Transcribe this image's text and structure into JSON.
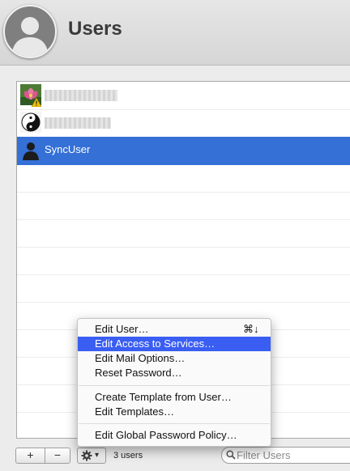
{
  "header": {
    "title": "Users",
    "avatar_icon": "user-silhouette-icon"
  },
  "users": [
    {
      "name": "",
      "icon": "lotus-photo-icon",
      "warning_icon": "warning-icon",
      "selected": false
    },
    {
      "name": "",
      "icon": "yin-yang-icon",
      "selected": false
    },
    {
      "name": "SyncUser",
      "icon": "user-silhouette-icon",
      "selected": true
    }
  ],
  "toolbar": {
    "add_label": "+",
    "remove_label": "−",
    "action_icon": "gear-icon",
    "action_arrow": "▾",
    "user_count": "3 users",
    "filter_placeholder": "Filter Users",
    "filter_icon": "search-icon"
  },
  "menu": {
    "items": [
      {
        "label": "Edit User…",
        "shortcut": "⌘↓",
        "highlighted": false
      },
      {
        "label": "Edit Access to Services…",
        "highlighted": true
      },
      {
        "label": "Edit Mail Options…",
        "highlighted": false
      },
      {
        "label": "Reset Password…",
        "highlighted": false
      },
      {
        "label": "Create Template from User…",
        "highlighted": false
      },
      {
        "label": "Edit Templates…",
        "highlighted": false
      },
      {
        "label": "Edit Global Password Policy…",
        "highlighted": false
      }
    ]
  },
  "colors": {
    "selection": "#3570d7",
    "menu_highlight": "#3a5ef2",
    "warning": "#f2c200"
  }
}
